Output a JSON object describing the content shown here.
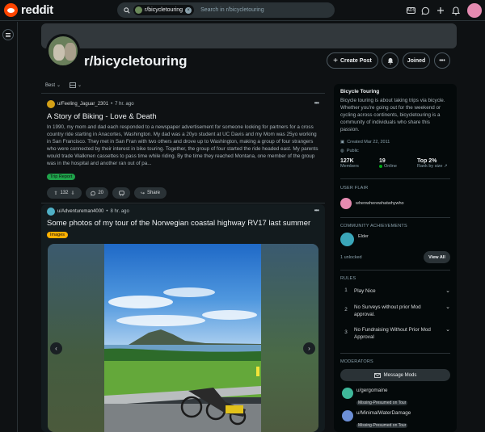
{
  "header": {
    "logo_text": "reddit",
    "search_chip": "r/bicycletouring",
    "search_placeholder": "Search in r/bicycletouring",
    "ad_label": "ADS",
    "icons": [
      "search-icon",
      "advertise-icon",
      "chat-icon",
      "create-icon",
      "notification-icon",
      "user-avatar"
    ]
  },
  "subreddit": {
    "name": "r/bicycletouring",
    "create_post_label": "Create Post",
    "joined_label": "Joined"
  },
  "feed_controls": {
    "sort_label": "Best",
    "view_label": ""
  },
  "posts": [
    {
      "author": "u/Feeling_Jaguar_2301",
      "age": "7 hr. ago",
      "title": "A Story of Biking - Love & Death",
      "body": "In 1990, my mom and dad each responded to a newspaper advertisement for someone looking for partners for a cross country ride starting in Anacortes, Washington. My dad was a 20yo student at UC Davis and my Mom was 25yo working in San Francisco. They met in San Fran with two others and drove up to Washington, making a group of four strangers who were connected by their interest in bike touring. Together, the group of four started the ride headed east. My parents would trade Walkmen cassettes to pass time while riding. By the time they reached Montana, one member of the group was in the hospital and another ran out of pa...",
      "flair": "Trip Report",
      "votes": "132",
      "comments": "20",
      "share_label": "Share"
    },
    {
      "author": "u/Adventureman4000",
      "age": "8 hr. ago",
      "title": "Some photos of my tour of the Norwegian coastal highway RV17 last summer",
      "flair": "Images"
    }
  ],
  "sidebar": {
    "title": "Bicycle Touring",
    "description": "Bicycle touring is about taking trips via bicycle. Whether you're going out for the weekend or cycling across continents, bicycletouring is a community of individuals who share this passion.",
    "created": "Created Mar 22, 2011",
    "visibility": "Public",
    "stats": [
      {
        "value": "127K",
        "label": "Members"
      },
      {
        "value": "19",
        "label": "Online"
      },
      {
        "value": "Top 2%",
        "label": "Rank by size"
      }
    ],
    "user_flair_heading": "USER FLAIR",
    "user_flair_name": "whenwherewhatwhywho",
    "achievements_heading": "COMMUNITY ACHIEVEMENTS",
    "achievement_name": "Elder",
    "unlocked": "1 unlocked",
    "view_all_label": "View All",
    "rules_heading": "RULES",
    "rules": [
      {
        "n": "1",
        "text": "Play Nice"
      },
      {
        "n": "2",
        "text": "No Surveys without prior Mod approval."
      },
      {
        "n": "3",
        "text": "No Fundraising Without Prior Mod Approval"
      }
    ],
    "moderators_heading": "MODERATORS",
    "message_mods_label": "Message Mods",
    "moderators": [
      {
        "name": "u/gergomaine",
        "flair": "Missing-Presumed on Tour"
      },
      {
        "name": "u/MinimalWaterDamage",
        "flair": "Missing-Presumed on Tour"
      }
    ]
  },
  "colors": {
    "background": "#0e1113",
    "accent": "#ff4500",
    "flair_trip": "#1fa24a",
    "flair_images": "#ffb000",
    "online_dot": "#01a816"
  }
}
